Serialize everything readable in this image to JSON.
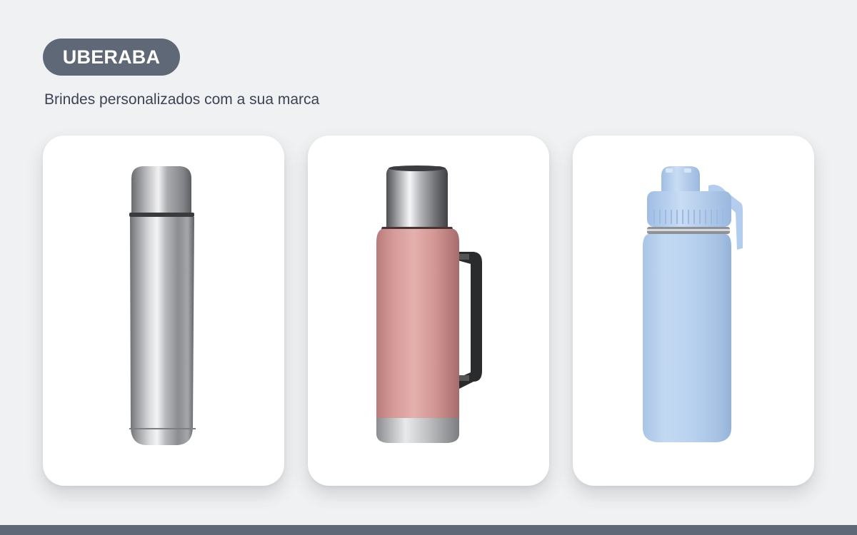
{
  "header": {
    "city": "UBERABA",
    "subtitle": "Brindes personalizados com a sua marca"
  },
  "colors": {
    "background": "#f0f1f3",
    "badge": "#5f6877",
    "card": "#ffffff",
    "subtitle_text": "#3b4452"
  },
  "products": [
    {
      "image": "stainless-steel-thermos-bottle",
      "color": "#a9abae"
    },
    {
      "image": "rose-thermos-bottle-with-black-handle",
      "color": "#d39a98"
    },
    {
      "image": "light-blue-sports-bottle",
      "color": "#b7d1ee"
    }
  ]
}
